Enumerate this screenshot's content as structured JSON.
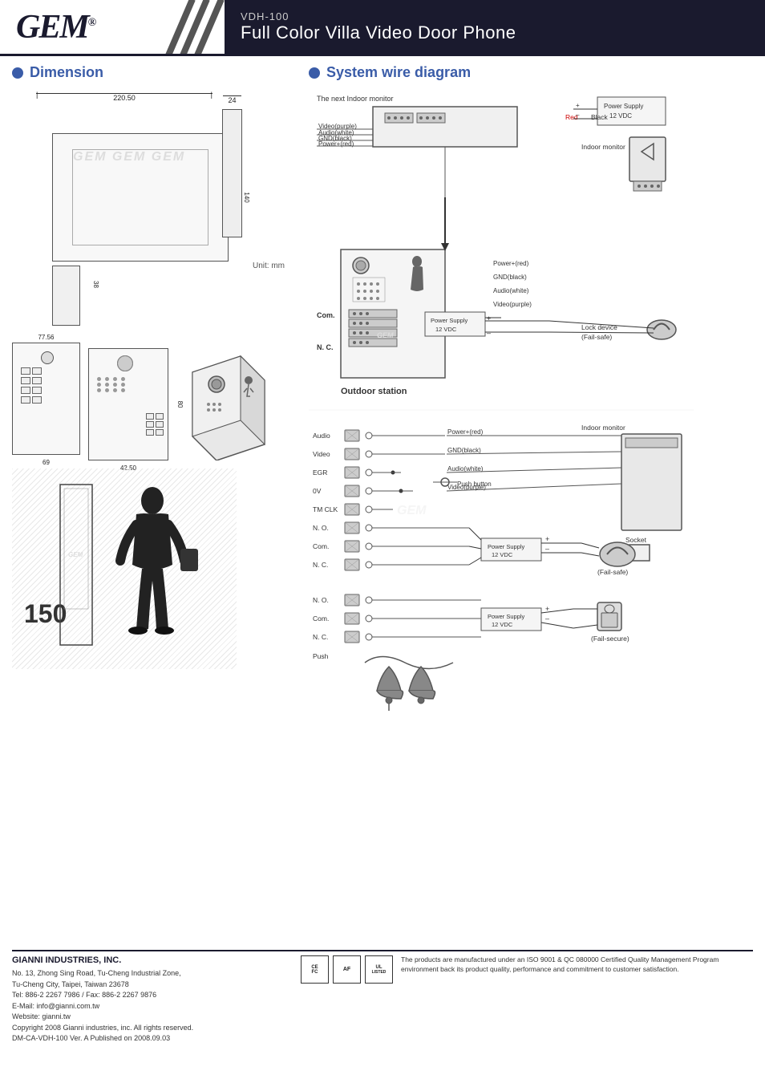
{
  "header": {
    "logo": "GEM",
    "logo_sup": "®",
    "model": "VDH-100",
    "product_name": "Full Color Villa Video Door Phone"
  },
  "dimension_section": {
    "title": "Dimension",
    "measurements": {
      "width": "220.50",
      "depth": "24",
      "height": "140",
      "small_height": "38",
      "bottom_width": "77.56",
      "bottom_left": "69",
      "bottom_right": "42.50",
      "bottom_detail_h": "80"
    },
    "unit": "Unit: mm",
    "scale": "150"
  },
  "wire_section": {
    "title": "System wire diagram",
    "indoor_label": "The next Indoor monitor",
    "power_supply_label": "Power Supply",
    "power_supply_voltage": "12 VDC",
    "red_label": "Red",
    "black_label": "Black",
    "indoor_monitor_label": "Indoor monitor",
    "wire_labels": [
      "Video(purple)",
      "Audio(white)",
      "GND(black)",
      "Power+(red)"
    ],
    "outdoor_wires": [
      "Power+(red)",
      "GND(black)",
      "Audio(white)",
      "Video(purple)"
    ],
    "outdoor_station_label": "Outdoor station",
    "lock_device_label": "Lock device",
    "fail_safe_label": "(Fail-safe)",
    "fail_secure_label": "(Fail-secure)",
    "com_label": "Com.",
    "nc_label": "N. C.",
    "terminal_labels": [
      "Audio",
      "Video",
      "EGR",
      "0V",
      "TM CLK",
      "N. O.",
      "Com.",
      "N. C."
    ],
    "terminal_labels2": [
      "N. O.",
      "Com.",
      "N. C.",
      "Push"
    ],
    "power_red_label": "Power+(red)",
    "gnd_black_label": "GND(black)",
    "audio_white_label": "Audio(white)",
    "video_purple_label": "Video(purple)",
    "push_button_label": "Push button",
    "socket_label": "Socket",
    "indoor_monitor2_label": "Indoor monitor"
  },
  "footer": {
    "company": "GIANNI INDUSTRIES, INC.",
    "address": "No. 13, Zhong Sing Road, Tu-Cheng Industrial Zone,",
    "city": "Tu-Cheng City, Taipei, Taiwan 23678",
    "tel": "Tel: 886-2 2267 7986 / Fax: 886-2 2267 9876",
    "email": "E-Mail: info@gianni.com.tw",
    "website": "Website: gianni.tw",
    "copyright": "Copyright 2008 Gianni industries, inc. All rights reserved.",
    "version": "DM-CA-VDH-100  Ver. A  Published on 2008.09.03",
    "iso_text": "The products are manufactured under an ISO 9001 & QC 080000 Certified Quality Management Program environment back its product quality, performance and commitment to customer satisfaction."
  }
}
